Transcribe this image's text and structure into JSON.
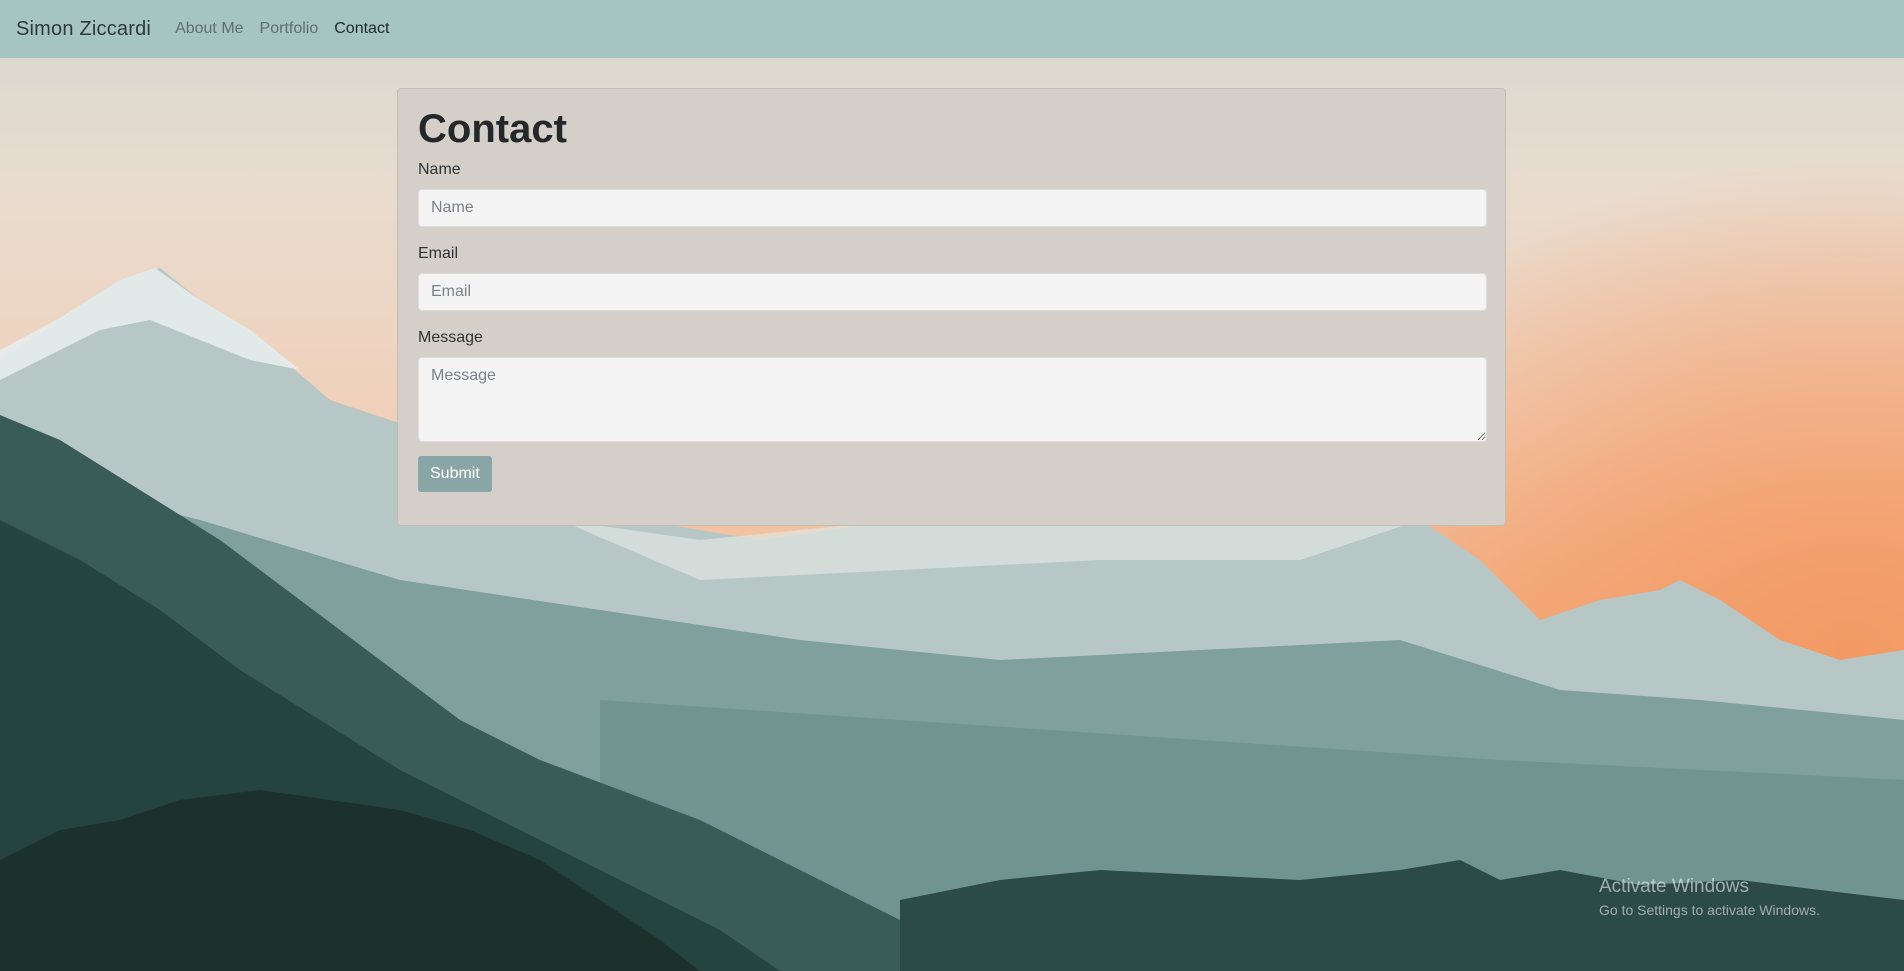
{
  "navbar": {
    "brand": "Simon Ziccardi",
    "links": [
      {
        "label": "About Me",
        "active": false
      },
      {
        "label": "Portfolio",
        "active": false
      },
      {
        "label": "Contact",
        "active": true
      }
    ],
    "background_color": "#a5c4c2"
  },
  "contact_form": {
    "title": "Contact",
    "name_label": "Name",
    "name_value": "",
    "name_placeholder": "Name",
    "email_label": "Email",
    "email_value": "",
    "email_placeholder": "Email",
    "message_label": "Message",
    "message_value": "",
    "message_placeholder": "Message",
    "submit_label": "Submit",
    "submit_color": "#8aa5a5"
  },
  "windows_watermark": {
    "title": "Activate Windows",
    "subtitle": "Go to Settings to activate Windows."
  },
  "background": {
    "description_colors": [
      "#f2a06e",
      "#e9dccf",
      "#5f8a86",
      "#1f3a37"
    ]
  }
}
